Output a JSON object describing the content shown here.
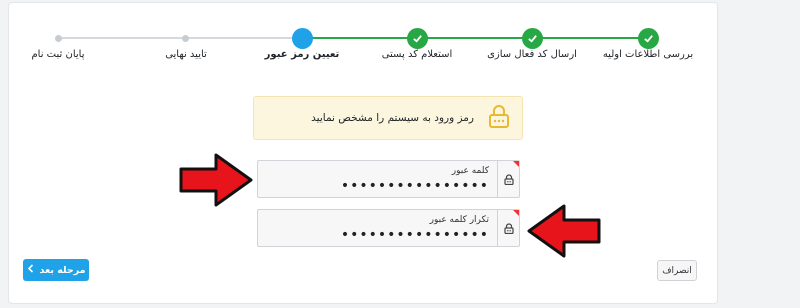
{
  "wizard": {
    "steps": [
      {
        "label": "بررسی اطلاعات اولیه",
        "state": "done"
      },
      {
        "label": "ارسال کد فعال سازی",
        "state": "done"
      },
      {
        "label": "استعلام کد پستی",
        "state": "done"
      },
      {
        "label": "تعیین رمز عبور",
        "state": "active"
      },
      {
        "label": "تایید نهایی",
        "state": "pending"
      },
      {
        "label": "پایان ثبت نام",
        "state": "pending"
      }
    ]
  },
  "alert": {
    "text": "رمز ورود به سیستم را مشخص نمایید",
    "icon": "lock-icon"
  },
  "form": {
    "password": {
      "label": "کلمه عبور",
      "value": "••••••••••••••••"
    },
    "confirm": {
      "label": "تکرار کلمه عبور",
      "value": "••••••••••••••••"
    }
  },
  "buttons": {
    "next_label": "مرحله بعد",
    "cancel_label": "انصراف"
  },
  "colors": {
    "done": "#28a745",
    "active": "#1fa2e8",
    "pending": "#c7ccd1",
    "arrow": "#e8141c",
    "alert_bg": "#fdf6df"
  }
}
